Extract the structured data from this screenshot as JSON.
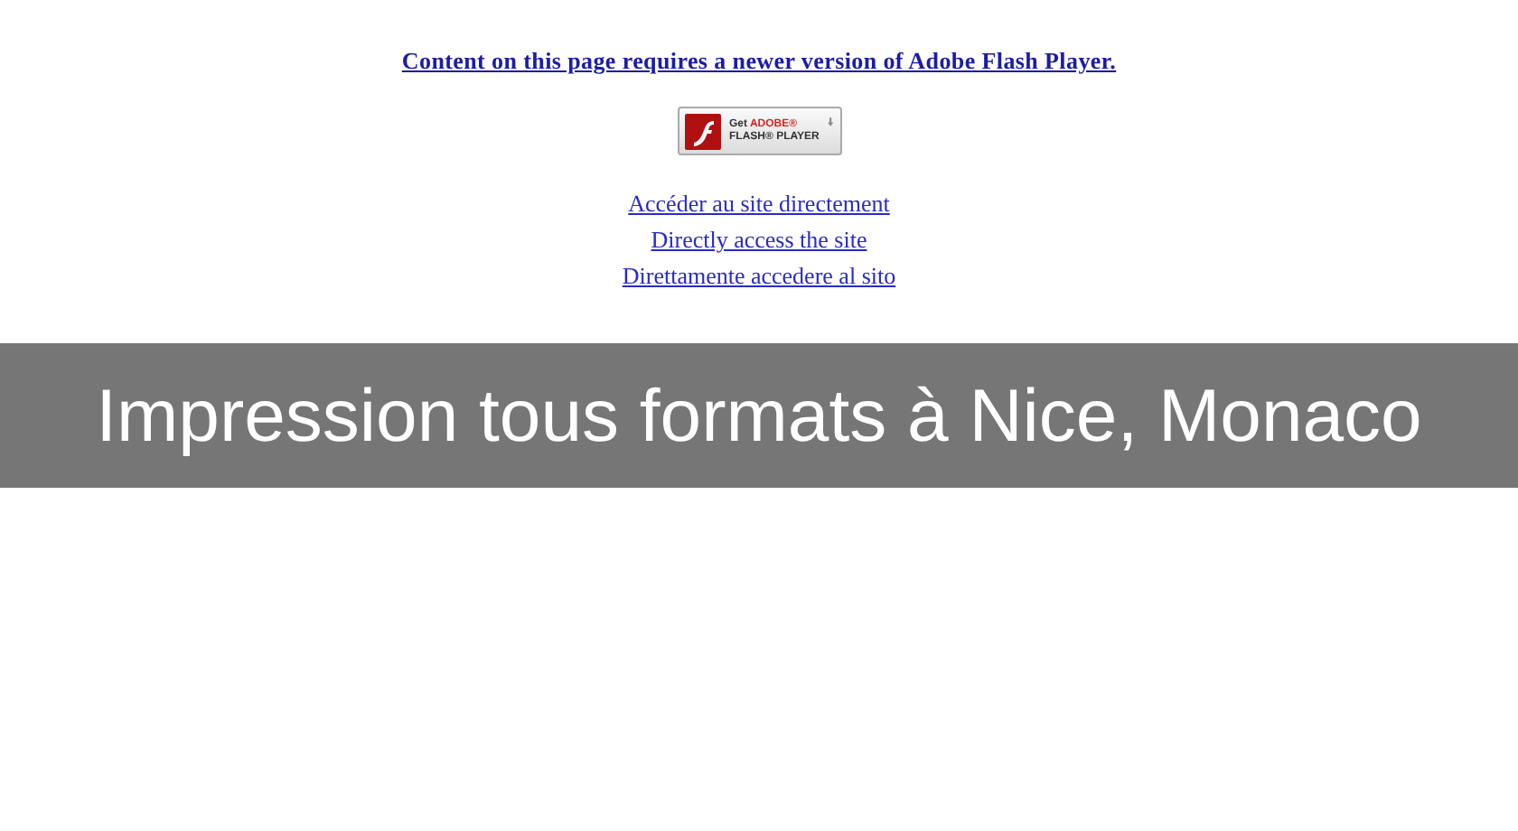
{
  "notice": {
    "message": "Content on this page requires a newer version of Adobe Flash Player.",
    "download_button": {
      "line_1_prefix": "Get",
      "line_1_brand": "ADOBE®",
      "line_2": "FLASH® PLAYER"
    },
    "links": [
      "Accéder au site directement",
      "Directly access the site",
      "Direttamente accedere al sito"
    ]
  },
  "banner": {
    "title": "Impression tous formats à Nice, Monaco"
  }
}
